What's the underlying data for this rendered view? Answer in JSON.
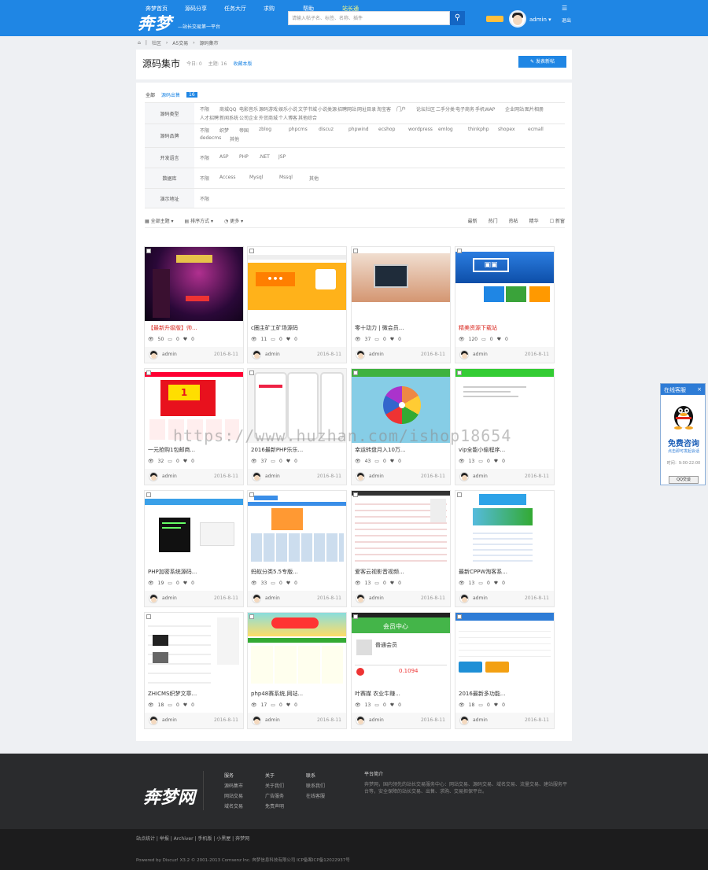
{
  "header": {
    "nav": [
      "奔梦首页",
      "源码分享",
      "任务大厅",
      "求购",
      "帮助",
      "站长通"
    ],
    "logo": "奔梦",
    "slogan": "—站长交易第一平台",
    "search_placeholder": "请输入帖子名、标签、名称、插件",
    "user": "admin",
    "logout": "退出"
  },
  "breadcrumb": [
    "社区",
    "A5交易",
    "源码集市"
  ],
  "forum": {
    "title": "源码集市",
    "today": "今日: 0",
    "topics": "主题: 16",
    "rss": "收藏本版",
    "post_button": "发表新帖"
  },
  "tabs": {
    "all": "全部",
    "active": "源码出售",
    "count": "16"
  },
  "filters": [
    {
      "label": "源码类型",
      "options": [
        "不限",
        "商城QQ",
        "电影音乐",
        "源码游戏",
        "娱乐小说",
        "文学书城",
        "小说类源",
        "招聘网站",
        "网址目录",
        "淘宝客",
        "门户",
        "论坛社区",
        "二手分类",
        "电子商务",
        "手机WAP",
        "企业网站",
        "图片相册",
        "人才招聘",
        "新闻系统",
        "公司企业",
        "外贸商城",
        "个人博客",
        "其他综合"
      ]
    },
    {
      "label": "源码品牌",
      "options": [
        "不限",
        "织梦",
        "帝国",
        "zblog",
        "phpcms",
        "discuz",
        "phpwind",
        "ecshop",
        "wordpress",
        "emlog",
        "thinkphp",
        "shopex",
        "ecmall",
        "dedecms",
        "其他"
      ]
    },
    {
      "label": "开发语言",
      "options": [
        "不限",
        "ASP",
        "PHP",
        ".NET",
        "JSP"
      ]
    },
    {
      "label": "数据库",
      "options": [
        "不限",
        "Access",
        "Mysql",
        "Mssql",
        "其他"
      ]
    },
    {
      "label": "演示地址",
      "options": [
        "不限"
      ]
    }
  ],
  "sortbar": {
    "left": [
      "全部主题",
      "排序方式",
      "更多"
    ],
    "right": [
      "最新",
      "热门",
      "热帖",
      "精华",
      "新窗"
    ]
  },
  "cards": [
    {
      "title": "【最新升级版】帅...",
      "red": true,
      "views": "50",
      "replies": "0",
      "likes": "0",
      "author": "admin",
      "date": "2016-8-11",
      "theme": "dark"
    },
    {
      "title": "c圈主矿工矿场源码",
      "red": false,
      "views": "11",
      "replies": "0",
      "likes": "0",
      "author": "admin",
      "date": "2016-8-11",
      "theme": "orange"
    },
    {
      "title": "零十动力 | 微会员...",
      "red": false,
      "views": "37",
      "replies": "0",
      "likes": "0",
      "author": "admin",
      "date": "2016-8-11",
      "theme": "office"
    },
    {
      "title": "精美资源下载站",
      "red": true,
      "views": "120",
      "replies": "0",
      "likes": "0",
      "author": "admin",
      "date": "2016-8-11",
      "theme": "blue"
    },
    {
      "title": "一元抢购1包邮商...",
      "red": false,
      "views": "32",
      "replies": "0",
      "likes": "0",
      "author": "admin",
      "date": "2016-8-11",
      "theme": "red"
    },
    {
      "title": "2016最新PHP乐乐...",
      "red": false,
      "views": "37",
      "replies": "0",
      "likes": "0",
      "author": "admin",
      "date": "2016-8-11",
      "theme": "phone"
    },
    {
      "title": "幸运转盘月入10万...",
      "red": false,
      "views": "43",
      "replies": "0",
      "likes": "0",
      "author": "admin",
      "date": "2016-8-11",
      "theme": "wheel"
    },
    {
      "title": "vip全能小偷程序...",
      "red": false,
      "views": "13",
      "replies": "0",
      "likes": "0",
      "author": "admin",
      "date": "2016-8-11",
      "theme": "white"
    },
    {
      "title": "PHP加密系统源码...",
      "red": false,
      "views": "19",
      "replies": "0",
      "likes": "0",
      "author": "admin",
      "date": "2016-8-11",
      "theme": "code"
    },
    {
      "title": "蚂蚁分类5.5专版...",
      "red": false,
      "views": "33",
      "replies": "0",
      "likes": "0",
      "author": "admin",
      "date": "2016-8-11",
      "theme": "portal"
    },
    {
      "title": "爱客云视影音视频...",
      "red": false,
      "views": "13",
      "replies": "0",
      "likes": "0",
      "author": "admin",
      "date": "2016-8-11",
      "theme": "list"
    },
    {
      "title": "最新CPPW淘客系...",
      "red": false,
      "views": "13",
      "replies": "0",
      "likes": "0",
      "author": "admin",
      "date": "2016-8-11",
      "theme": "shop"
    },
    {
      "title": "ZHICMS织梦文章...",
      "red": false,
      "views": "18",
      "replies": "0",
      "likes": "0",
      "author": "admin",
      "date": "2016-8-11",
      "theme": "news"
    },
    {
      "title": "php48赛系统,网站...",
      "red": false,
      "views": "17",
      "replies": "0",
      "likes": "0",
      "author": "admin",
      "date": "2016-8-11",
      "theme": "kids"
    },
    {
      "title": "叶赛媒 农业牛赚...",
      "red": false,
      "views": "13",
      "replies": "0",
      "likes": "0",
      "author": "admin",
      "date": "2016-8-11",
      "theme": "member"
    },
    {
      "title": "2016最新多功能...",
      "red": false,
      "views": "18",
      "replies": "0",
      "likes": "0",
      "author": "admin",
      "date": "2016-8-11",
      "theme": "pay"
    }
  ],
  "watermark": "https://www.huzhan.com/ishop18654",
  "qq_widget": {
    "title": "在线客服",
    "headline": "免费咨询",
    "sub": "点击即可发起会话",
    "time": "时间：9:00-22:00",
    "button": "QQ交谈"
  },
  "footer": {
    "logo": "奔梦网",
    "cols": [
      {
        "title": "服务",
        "items": [
          "源码集市",
          "网站交易",
          "域名交易"
        ]
      },
      {
        "title": "关于",
        "items": [
          "关于我们",
          "广告服务",
          "免责声明"
        ]
      },
      {
        "title": "联系",
        "items": [
          "联系我们",
          "在线客服"
        ]
      }
    ],
    "intro_title": "平台简介",
    "intro": "奔梦网，国内领先的站长交易服务中心：网站交易、源码交易、域名交易、流量交易、建站服务平台等，安全保障的站长交易、出售、求购、交易担保平台。",
    "links": "站点统计 | 举报 | Archiver | 手机版 | 小黑屋 | 奔梦网",
    "copy": "Powered by Discuz! X3.2  © 2001-2013 Comsenz Inc.  奔梦信息科技有限公司  ICP备案ICP备12022937号"
  }
}
